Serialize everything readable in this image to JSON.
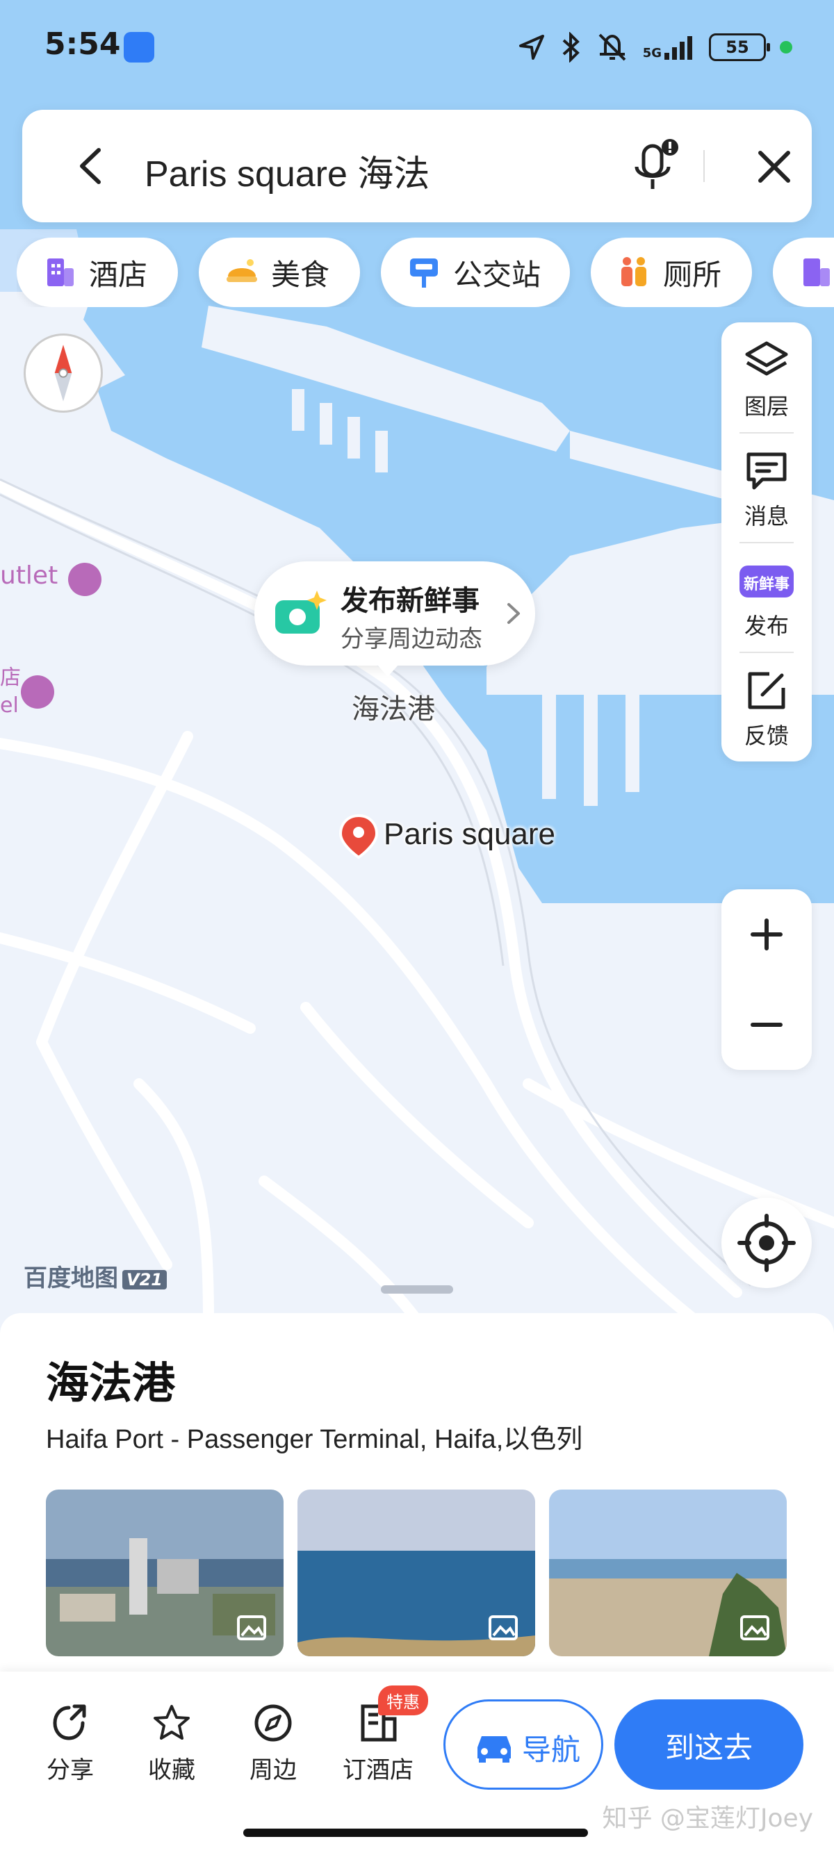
{
  "status_bar": {
    "time": "5:54",
    "network": "5G",
    "battery": "55"
  },
  "search": {
    "query": "Paris square 海法"
  },
  "categories": [
    {
      "label": "酒店",
      "icon": "hotel-icon",
      "color": "#8b63f2"
    },
    {
      "label": "美食",
      "icon": "food-icon",
      "color": "#f5a623"
    },
    {
      "label": "公交站",
      "icon": "bus-stop-icon",
      "color": "#3a86f7"
    },
    {
      "label": "厕所",
      "icon": "toilet-icon",
      "color": "#f26b4a"
    }
  ],
  "tools": [
    {
      "label": "图层",
      "icon": "layers-icon"
    },
    {
      "label": "消息",
      "icon": "message-icon"
    },
    {
      "label": "发布",
      "icon": "publish-icon",
      "badge_text": "新鲜事"
    },
    {
      "label": "反馈",
      "icon": "feedback-icon"
    }
  ],
  "callout": {
    "title": "发布新鲜事",
    "subtitle": "分享周边动态"
  },
  "map": {
    "port_label": "海法港",
    "pin_label": "Paris square",
    "poi_left_1": "utlet",
    "poi_left_2": "店",
    "poi_left_3": "el",
    "watermark": "百度地图",
    "watermark_version": "V21",
    "colors": {
      "water": "#9ccff8",
      "land": "#eef3fb",
      "road": "#ffffff"
    }
  },
  "place": {
    "title": "海法港",
    "subtitle": "Haifa Port - Passenger Terminal, Haifa,以色列"
  },
  "actions": [
    {
      "label": "分享",
      "icon": "share-icon"
    },
    {
      "label": "收藏",
      "icon": "star-icon"
    },
    {
      "label": "周边",
      "icon": "compass-icon"
    },
    {
      "label": "订酒店",
      "icon": "hotel-booking-icon",
      "badge": "特惠"
    }
  ],
  "buttons": {
    "navigate": "导航",
    "go_here": "到这去"
  },
  "footer_watermark": "知乎 @宝莲灯Joey",
  "accent_color": "#2f7cf6"
}
